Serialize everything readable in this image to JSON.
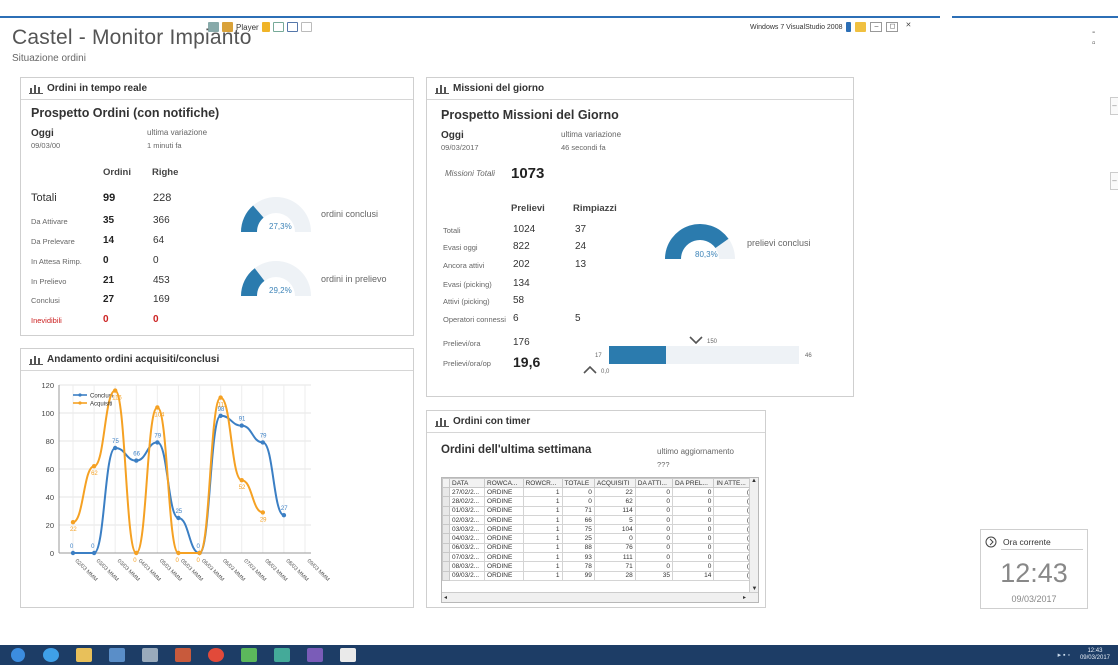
{
  "app": {
    "title": "Castel - Monitor Impianto",
    "subtitle": "Situazione ordini",
    "player_label": "Player",
    "vs_label": "Windows 7 VisualStudio 2008"
  },
  "panel_ordini": {
    "header": "Ordini in tempo reale",
    "title": "Prospetto Ordini (con notifiche)",
    "oggi_label": "Oggi",
    "oggi_value": "09/03/00",
    "ultima_label": "ultima variazione",
    "ultima_value": "1 minuti fa",
    "col_ordini": "Ordini",
    "col_righe": "Righe",
    "rows": [
      {
        "label": "Totali",
        "ordini": "99",
        "righe": "228"
      },
      {
        "label": "Da Attivare",
        "ordini": "35",
        "righe": "366"
      },
      {
        "label": "Da Prelevare",
        "ordini": "14",
        "righe": "64"
      },
      {
        "label": "In Attesa Rimp.",
        "ordini": "0",
        "righe": "0"
      },
      {
        "label": "In Prelievo",
        "ordini": "21",
        "righe": "453"
      },
      {
        "label": "Conclusi",
        "ordini": "27",
        "righe": "169"
      },
      {
        "label": "Inevidibili",
        "ordini": "0",
        "righe": "0"
      }
    ],
    "gauge1": {
      "value": "27,3%",
      "fraction": 0.273,
      "caption": "ordini conclusi"
    },
    "gauge2": {
      "value": "29,2%",
      "fraction": 0.292,
      "caption": "ordini in prelievo"
    }
  },
  "panel_missioni": {
    "header": "Missioni del giorno",
    "title": "Prospetto Missioni del Giorno",
    "oggi_label": "Oggi",
    "oggi_value": "09/03/2017",
    "ultima_label": "ultima variazione",
    "ultima_value": "46 secondi fa",
    "missioni_label": "Missioni Totali",
    "missioni_value": "1073",
    "col_prelievi": "Prelievi",
    "col_rimpiazzi": "Rimpiazzi",
    "rows": [
      {
        "label": "Totali",
        "prelievi": "1024",
        "rimpiazzi": "37"
      },
      {
        "label": "Evasi oggi",
        "prelievi": "822",
        "rimpiazzi": "24"
      },
      {
        "label": "Ancora attivi",
        "prelievi": "202",
        "rimpiazzi": "13"
      },
      {
        "label": "Evasi (picking)",
        "prelievi": "134",
        "rimpiazzi": ""
      },
      {
        "label": "Attivi (picking)",
        "prelievi": "58",
        "rimpiazzi": ""
      },
      {
        "label": "Operatori connessi",
        "prelievi": "6",
        "rimpiazzi": "5"
      }
    ],
    "prelievi_ora_label": "Prelievi/ora",
    "prelievi_ora_value": "176",
    "prelievi_op_label": "Prelievi/ora/op",
    "prelievi_op_value": "19,6",
    "gauge": {
      "value": "80,3%",
      "fraction": 0.803,
      "caption": "prelievi conclusi"
    },
    "bar": {
      "min_label": "17",
      "max_label": "46",
      "fraction": 0.3,
      "marker_hi": "150",
      "marker_lo": "0,0"
    }
  },
  "panel_andamento": {
    "header": "Andamento ordini acquisiti/conclusi"
  },
  "chart_data": {
    "type": "line",
    "title": "",
    "xlabel": "",
    "ylabel": "",
    "ylim": [
      0,
      120
    ],
    "yticks": [
      "0",
      "20",
      "40",
      "60",
      "80",
      "100",
      "120"
    ],
    "categories": [
      "02/03 MMM",
      "03/03 MMM",
      "03/03 MMM",
      "04/03 MMM",
      "05/03 MMM",
      "05/03 MMM",
      "06/03 MMM",
      "06/03 MMM",
      "07/03 MMM",
      "08/03 MMM",
      "08/03 MMM",
      "09/03 MMM"
    ],
    "series": [
      {
        "name": "Conclusi",
        "color": "#3b7fc4",
        "values": [
          0,
          0,
          75,
          66,
          79,
          25,
          0,
          98,
          91,
          79,
          27,
          null
        ]
      },
      {
        "name": "Acquisiti",
        "color": "#f5a123",
        "values": [
          22,
          62,
          116,
          0,
          104,
          0,
          0,
          111,
          52,
          29,
          null,
          null
        ]
      }
    ],
    "legend_position": "top-left"
  },
  "panel_timer": {
    "header": "Ordini con timer",
    "title": "Ordini  dell'ultima settimana",
    "agg_label": "ultimo aggiornamento",
    "agg_value": "???",
    "columns": [
      "DATA",
      "ROWCA...",
      "ROWCR...",
      "TOTALE",
      "ACQUISITI",
      "DA ATTI...",
      "DA PREL...",
      "IN ATTE..."
    ],
    "rows": [
      [
        "27/02/2...",
        "ORDINE",
        "1",
        "0",
        "22",
        "0",
        "0",
        "("
      ],
      [
        "28/02/2...",
        "ORDINE",
        "1",
        "0",
        "62",
        "0",
        "0",
        "("
      ],
      [
        "01/03/2...",
        "ORDINE",
        "1",
        "71",
        "114",
        "0",
        "0",
        "("
      ],
      [
        "02/03/2...",
        "ORDINE",
        "1",
        "66",
        "5",
        "0",
        "0",
        "("
      ],
      [
        "03/03/2...",
        "ORDINE",
        "1",
        "75",
        "104",
        "0",
        "0",
        "("
      ],
      [
        "04/03/2...",
        "ORDINE",
        "1",
        "25",
        "0",
        "0",
        "0",
        "("
      ],
      [
        "06/03/2...",
        "ORDINE",
        "1",
        "88",
        "76",
        "0",
        "0",
        "("
      ],
      [
        "07/03/2...",
        "ORDINE",
        "1",
        "93",
        "111",
        "0",
        "0",
        "("
      ],
      [
        "08/03/2...",
        "ORDINE",
        "1",
        "78",
        "71",
        "0",
        "0",
        "("
      ],
      [
        "09/03/2...",
        "ORDINE",
        "1",
        "99",
        "28",
        "35",
        "14",
        "("
      ]
    ]
  },
  "clock": {
    "label": "Ora corrente",
    "time": "12:43",
    "date": "09/03/2017"
  },
  "taskbar": {
    "time": "12:43",
    "date": "09/03/2017"
  }
}
